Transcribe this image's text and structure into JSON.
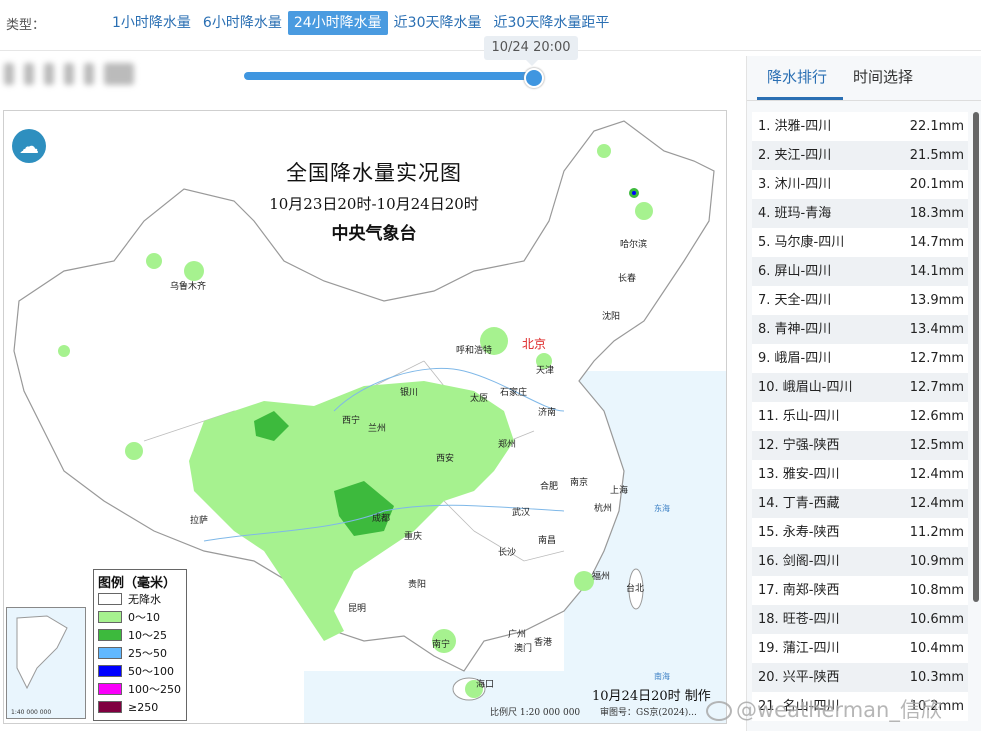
{
  "typebar": {
    "label": "类型：",
    "tabs": [
      "1小时降水量",
      "6小时降水量",
      "24小时降水量",
      "近30天降水量",
      "近30天降水量距平"
    ],
    "active_index": 2
  },
  "slider": {
    "time_label": "10/24 20:00",
    "position_fraction": 1.0
  },
  "map": {
    "title": "全国降水量实况图",
    "subtitle": "10月23日20时-10月24日20时",
    "org": "中央气象台",
    "legend_title": "图例（毫米）",
    "legend": [
      {
        "label": "无降水",
        "color": "#ffffff"
      },
      {
        "label": "0～10",
        "color": "#a6f28f"
      },
      {
        "label": "10～25",
        "color": "#3dba3d"
      },
      {
        "label": "25～50",
        "color": "#61b8ff"
      },
      {
        "label": "50～100",
        "color": "#0000ff"
      },
      {
        "label": "100～250",
        "color": "#fa00fa"
      },
      {
        "label": "≥250",
        "color": "#800040"
      }
    ],
    "made_text": "10月24日20时 制作",
    "scale_text": "比例尺 1:20 000 000",
    "review_text": "审图号：GS京(2024)...",
    "inset_scale": "1:40 000 000",
    "cities": {
      "wulumuqi": "乌鲁木齐",
      "haerbin": "哈尔滨",
      "changchun": "长春",
      "shenyang": "沈阳",
      "huhehaote": "呼和浩特",
      "beijing": "北京",
      "tianjin": "天津",
      "shijiazhuang": "石家庄",
      "taiyuan": "太原",
      "yinchuan": "银川",
      "xining": "西宁",
      "lanzhou": "兰州",
      "jinan": "济南",
      "zhengzhou": "郑州",
      "xian": "西安",
      "hefei": "合肥",
      "nanjing": "南京",
      "shanghai": "上海",
      "hangzhou": "杭州",
      "wuhan": "武汉",
      "chengdu": "成都",
      "lasa": "拉萨",
      "chongqing": "重庆",
      "changsha": "长沙",
      "nanchang": "南昌",
      "fuzhou": "福州",
      "taibei": "台北",
      "guiyang": "贵阳",
      "kunming": "昆明",
      "nanning": "南宁",
      "guangzhou": "广州",
      "aomen": "澳门",
      "xianggang": "香港",
      "haikou": "海口"
    },
    "seas": {
      "east": "东海",
      "south": "南海"
    }
  },
  "panel": {
    "tabs": [
      "降水排行",
      "时间选择"
    ],
    "ranking": [
      {
        "name": "1. 洪雅-四川",
        "value": "22.1mm"
      },
      {
        "name": "2. 夹江-四川",
        "value": "21.5mm"
      },
      {
        "name": "3. 沐川-四川",
        "value": "20.1mm"
      },
      {
        "name": "4. 班玛-青海",
        "value": "18.3mm"
      },
      {
        "name": "5. 马尔康-四川",
        "value": "14.7mm"
      },
      {
        "name": "6. 屏山-四川",
        "value": "14.1mm"
      },
      {
        "name": "7. 天全-四川",
        "value": "13.9mm"
      },
      {
        "name": "8. 青神-四川",
        "value": "13.4mm"
      },
      {
        "name": "9. 峨眉-四川",
        "value": "12.7mm"
      },
      {
        "name": "10. 峨眉山-四川",
        "value": "12.7mm"
      },
      {
        "name": "11. 乐山-四川",
        "value": "12.6mm"
      },
      {
        "name": "12. 宁强-陕西",
        "value": "12.5mm"
      },
      {
        "name": "13. 雅安-四川",
        "value": "12.4mm"
      },
      {
        "name": "14. 丁青-西藏",
        "value": "12.4mm"
      },
      {
        "name": "15. 永寿-陕西",
        "value": "11.2mm"
      },
      {
        "name": "16. 剑阁-四川",
        "value": "10.9mm"
      },
      {
        "name": "17. 南郑-陕西",
        "value": "10.8mm"
      },
      {
        "name": "18. 旺苍-四川",
        "value": "10.6mm"
      },
      {
        "name": "19. 蒲江-四川",
        "value": "10.4mm"
      },
      {
        "name": "20. 兴平-陕西",
        "value": "10.3mm"
      },
      {
        "name": "21. 名山-四川",
        "value": "10.2mm"
      }
    ]
  },
  "watermark": "@weatherman_信欣"
}
